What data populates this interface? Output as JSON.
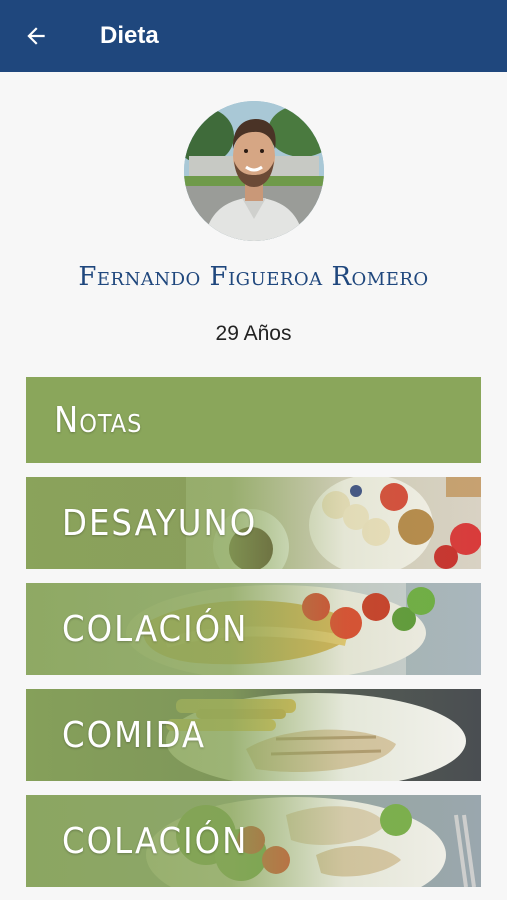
{
  "appbar": {
    "title": "Dieta",
    "back_icon": "arrow-left-icon",
    "color": "#1f477d"
  },
  "profile": {
    "name": "Fernando Figueroa Romero",
    "age": "29 Años"
  },
  "sections": [
    {
      "label": "Notas",
      "theme": "#8aa65b"
    },
    {
      "label": "DESAYUNO",
      "image": "breakfast-photo"
    },
    {
      "label": "COLACIÓN",
      "image": "omelette-photo"
    },
    {
      "label": "COMIDA",
      "image": "chicken-fries-photo"
    },
    {
      "label": "COLACIÓN",
      "image": "chicken-salad-photo"
    }
  ]
}
